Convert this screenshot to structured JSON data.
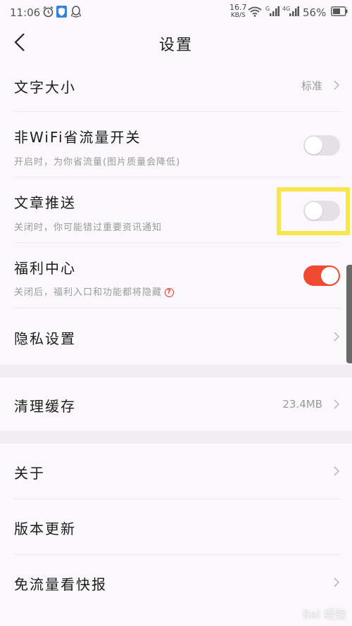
{
  "status_bar": {
    "time": "11:06",
    "net_speed_value": "16.7",
    "net_speed_unit": "KB/S",
    "battery": "56%"
  },
  "header": {
    "title": "设置"
  },
  "settings": {
    "font_size": {
      "label": "文字大小",
      "value": "标准"
    },
    "wifi_saver": {
      "label": "非WiFi省流量开关",
      "sub": "开启时，为你省流量(图片质量会降低)",
      "on": false
    },
    "article_push": {
      "label": "文章推送",
      "sub": "关闭时，你可能错过重要资讯通知",
      "on": false
    },
    "welfare": {
      "label": "福利中心",
      "sub": "关闭后，福利入口和功能都将隐藏",
      "on": true
    },
    "privacy": {
      "label": "隐私设置"
    },
    "cache": {
      "label": "清理缓存",
      "value": "23.4MB"
    },
    "about": {
      "label": "关于"
    },
    "update": {
      "label": "版本更新"
    },
    "free_flow": {
      "label": "免流量看快报"
    }
  },
  "colors": {
    "toggle_on": "#f04b32",
    "highlight": "#f7e64c"
  },
  "watermark": "Bai 经验"
}
